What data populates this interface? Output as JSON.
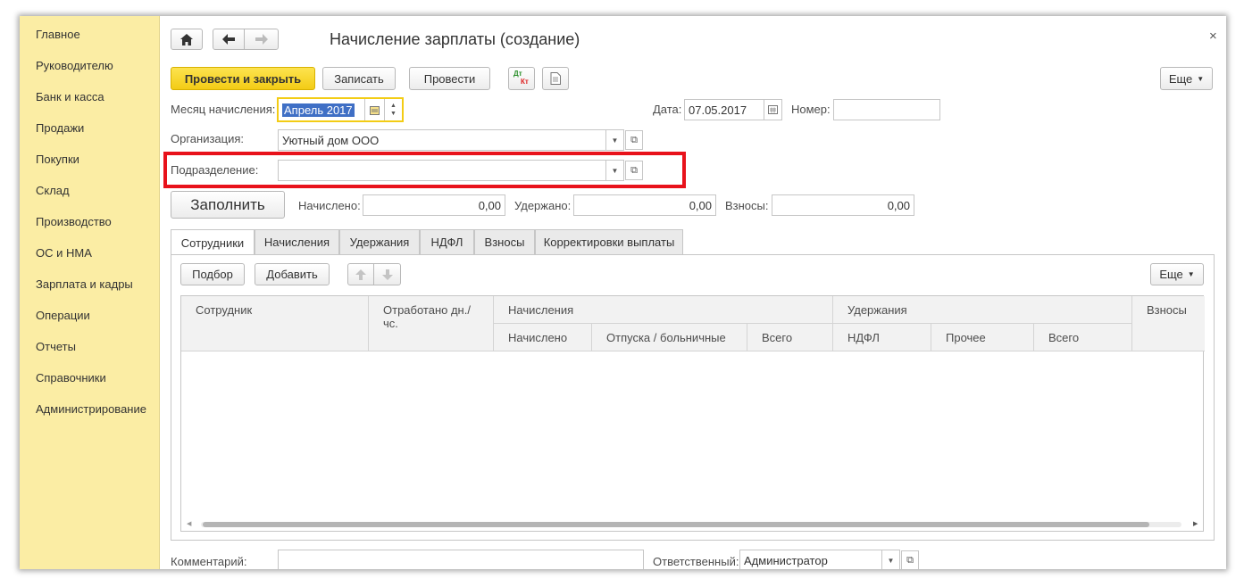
{
  "sidebar": {
    "items": [
      {
        "label": "Главное"
      },
      {
        "label": "Руководителю"
      },
      {
        "label": "Банк и касса"
      },
      {
        "label": "Продажи"
      },
      {
        "label": "Покупки"
      },
      {
        "label": "Склад"
      },
      {
        "label": "Производство"
      },
      {
        "label": "ОС и НМА"
      },
      {
        "label": "Зарплата и кадры"
      },
      {
        "label": "Операции"
      },
      {
        "label": "Отчеты"
      },
      {
        "label": "Справочники"
      },
      {
        "label": "Администрирование"
      }
    ]
  },
  "header": {
    "title": "Начисление зарплаты (создание)",
    "close": "×"
  },
  "toolbar": {
    "post_close": "Провести и закрыть",
    "save": "Записать",
    "post": "Провести",
    "dtkt_top": "Дт",
    "dtkt_bottom": "Кт",
    "more": "Еще"
  },
  "form": {
    "month_label": "Месяц начисления:",
    "month_value": "Апрель 2017",
    "date_label": "Дата:",
    "date_value": "07.05.2017",
    "number_label": "Номер:",
    "number_value": "",
    "org_label": "Организация:",
    "org_value": "Уютный дом ООО",
    "dept_label": "Подразделение:",
    "dept_value": "",
    "fill_button": "Заполнить",
    "accrued_label": "Начислено:",
    "accrued_value": "0,00",
    "withheld_label": "Удержано:",
    "withheld_value": "0,00",
    "contrib_label": "Взносы:",
    "contrib_value": "0,00",
    "comment_label": "Комментарий:",
    "comment_value": "",
    "responsible_label": "Ответственный:",
    "responsible_value": "Администратор"
  },
  "tabs": [
    {
      "label": "Сотрудники",
      "active": true
    },
    {
      "label": "Начисления"
    },
    {
      "label": "Удержания"
    },
    {
      "label": "НДФЛ"
    },
    {
      "label": "Взносы"
    },
    {
      "label": "Корректировки выплаты"
    }
  ],
  "table_toolbar": {
    "pick": "Подбор",
    "add": "Добавить",
    "more": "Еще"
  },
  "table": {
    "col_employee": "Сотрудник",
    "col_worked": "Отработано дн./чс.",
    "group_accruals": "Начисления",
    "col_accrued": "Начислено",
    "col_vacation": "Отпуска / больничные",
    "col_total1": "Всего",
    "group_deductions": "Удержания",
    "col_ndfl": "НДФЛ",
    "col_other": "Прочее",
    "col_total2": "Всего",
    "col_contrib": "Взносы",
    "rows": []
  },
  "colors": {
    "sidebar_bg": "#fbeda4",
    "primary_button": "#f3cc15",
    "highlight_box": "#e8121b",
    "selection": "#3f6fc5"
  }
}
